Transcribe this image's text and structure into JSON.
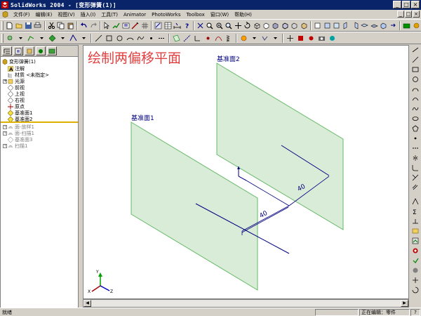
{
  "window": {
    "title": "SolidWorks 2004 - [变形弹簧(1)]",
    "controls": [
      "_",
      "□",
      "×"
    ]
  },
  "menu": [
    "文件(F)",
    "编辑(E)",
    "视图(V)",
    "插入(I)",
    "工具(T)",
    "Animator",
    "PhotoWorks",
    "Toolbox",
    "窗口(W)",
    "帮助(H)"
  ],
  "tree": {
    "root": "变形弹簧(1)",
    "items": [
      {
        "label": "注解",
        "icon": "annotation-icon",
        "indent": 1
      },
      {
        "label": "材质 <未指定>",
        "icon": "material-icon",
        "indent": 1
      },
      {
        "label": "光源",
        "icon": "lighting-icon",
        "indent": 1,
        "expander": "+"
      },
      {
        "label": "前视",
        "icon": "plane-icon",
        "indent": 1
      },
      {
        "label": "上视",
        "icon": "plane-icon",
        "indent": 1
      },
      {
        "label": "右视",
        "icon": "plane-icon",
        "indent": 1
      },
      {
        "label": "原点",
        "icon": "origin-icon",
        "indent": 1
      },
      {
        "label": "基准面1",
        "icon": "plane-icon",
        "indent": 1,
        "highlight": true
      },
      {
        "label": "基准面2",
        "icon": "plane-icon",
        "indent": 1,
        "highlight": true
      },
      {
        "label": "面-放样1",
        "icon": "feature-icon",
        "indent": 0,
        "expander": "+",
        "suppressed": true
      },
      {
        "label": "面-扫描1",
        "icon": "feature-icon",
        "indent": 0,
        "expander": "+",
        "suppressed": true
      },
      {
        "label": "基准面3",
        "icon": "plane-icon",
        "indent": 1,
        "suppressed": true
      },
      {
        "label": "扫描1",
        "icon": "feature-icon",
        "indent": 0,
        "expander": "+",
        "suppressed": true
      }
    ]
  },
  "viewport": {
    "heading": "绘制两偏移平面",
    "plane1_label": "基准面1",
    "plane2_label": "基准面2",
    "dim1": "40",
    "dim2": "40",
    "triad": {
      "x": "X",
      "y": "Y",
      "z": "Z"
    }
  },
  "status": {
    "left": "就绪",
    "mode": "正在编辑：零件",
    "help": "?"
  },
  "colors": {
    "plane_fill": "#d8ecd8",
    "plane_edge": "#66b866",
    "dimension": "#000080",
    "heading": "#e04040",
    "titlebar": "#0a246a"
  }
}
